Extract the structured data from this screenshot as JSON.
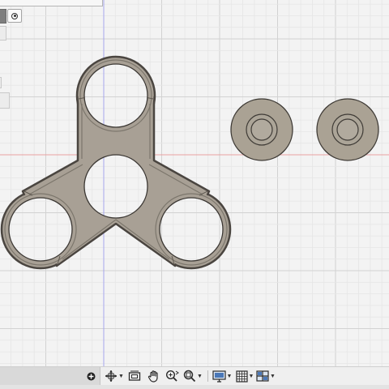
{
  "viewport": {
    "background": "#f3f3f3",
    "grid_minor_color": "#e6e6e6",
    "grid_major_color": "#d2d2d2",
    "x_axis_color": "#e8a0a0",
    "y_axis_color": "#a6a6ee"
  },
  "model": {
    "spinner_fill": "#a8a095",
    "spinner_edge": "#4a4540",
    "bearing_cap_fill": "#aaa294",
    "parts": [
      "spinner-body",
      "bearing-cap-left",
      "bearing-cap-right"
    ]
  },
  "left_panel": {
    "radio_icon": "radio-selected-icon"
  },
  "toolbar": {
    "icons": [
      "add-circle-icon",
      "orbit-icon",
      "look-at-icon",
      "pan-hand-icon",
      "zoom-icon",
      "fit-zoom-icon",
      "display-settings-icon",
      "grid-settings-icon",
      "viewports-icon"
    ]
  }
}
